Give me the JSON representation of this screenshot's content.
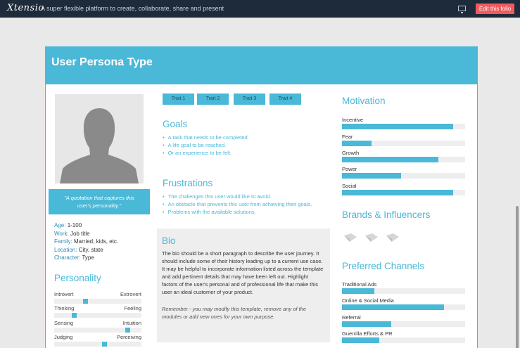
{
  "topbar": {
    "logo": "Xtensio",
    "tagline": "A super flexible platform to create, collaborate, share and present",
    "present_icon": "monitor-icon",
    "edit_button": "Edit this folio"
  },
  "persona": {
    "title": "User Persona Type",
    "quote": "\"A quotation that captures this user's personality.\"",
    "details": [
      {
        "key": "Age:",
        "value": " 1-100"
      },
      {
        "key": "Work:",
        "value": " Job title"
      },
      {
        "key": "Family:",
        "value": " Married, kids, etc."
      },
      {
        "key": "Location:",
        "value": " City, state"
      },
      {
        "key": "Character:",
        "value": " Type"
      }
    ]
  },
  "personality": {
    "heading": "Personality",
    "rows": [
      {
        "left": "Introvert",
        "right": "Extrovert",
        "level": 0.36
      },
      {
        "left": "Thinking",
        "right": "Feeling",
        "level": 0.23
      },
      {
        "left": "Sensing",
        "right": "Intuition",
        "level": 0.84
      },
      {
        "left": "Judging",
        "right": "Perceiving",
        "level": 0.58
      }
    ]
  },
  "traits": [
    "Trait 1",
    "Trait 2",
    "Trait 3",
    "Trait 4"
  ],
  "goals": {
    "heading": "Goals",
    "items": [
      "A task that needs to be completed.",
      "A life goal to be reached.",
      "Or an experience to be felt."
    ]
  },
  "frustrations": {
    "heading": "Frustrations",
    "items": [
      "The challenges this user would like to avoid.",
      "An obstacle that prevents this user from achieving their goals.",
      "Problems with the available solutions."
    ]
  },
  "bio": {
    "heading": "Bio",
    "text": "The bio should be a short paragraph to describe the user journey. It should include some of their history leading up to a current use case. It may be helpful to incorporate information listed across the template and add pertinent details that may have been left out. Highlight factors of the user's personal and of professional life that make this user an ideal customer of your product.",
    "note": "Remember - you may modify this template, remove any of the modules or add new ones for your own purpose."
  },
  "motivation": {
    "heading": "Motivation",
    "items": [
      {
        "label": "Incentive",
        "level": 0.9
      },
      {
        "label": "Fear",
        "level": 0.24
      },
      {
        "label": "Growth",
        "level": 0.78
      },
      {
        "label": "Power",
        "level": 0.48
      },
      {
        "label": "Social",
        "level": 0.9
      }
    ]
  },
  "brands": {
    "heading": "Brands & Influencers",
    "icons": [
      "brand-placeholder-icon",
      "brand-placeholder-icon",
      "brand-placeholder-icon"
    ]
  },
  "channels": {
    "heading": "Preferred Channels",
    "items": [
      {
        "label": "Traditional Ads",
        "level": 0.26
      },
      {
        "label": "Online & Social Media",
        "level": 0.83
      },
      {
        "label": "Referral",
        "level": 0.4
      },
      {
        "label": "Guerrilla Efforts & PR",
        "level": 0.3
      }
    ]
  },
  "colors": {
    "accent": "#4ab8d7",
    "topbar": "#1d2b3a",
    "edit": "#f15a5e"
  }
}
